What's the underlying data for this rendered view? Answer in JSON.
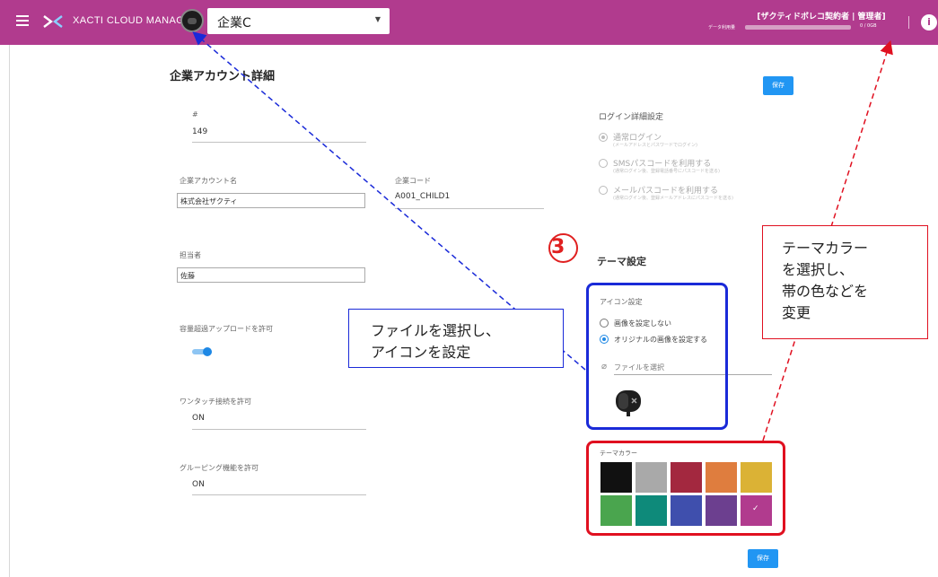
{
  "header": {
    "app_title": "XACTI CLOUD MANAGER",
    "company_selected": "企業C",
    "user_role": "[ザクティドボレコ契約者 | 管理者]",
    "usage_label": "データ利用量",
    "usage_text": "0 / 0GB",
    "usage_fraction": 0,
    "info_icon": "i",
    "accent_color": "#b13b8e"
  },
  "page": {
    "title": "企業アカウント詳細",
    "save_label": "保存"
  },
  "fields": {
    "id_label": "#",
    "id_value": "149",
    "company_name_label": "企業アカウント名",
    "company_name_value": "株式会社ザクティ",
    "company_code_label": "企業コード",
    "company_code_value": "A001_CHILD1",
    "contact_label": "担当者",
    "contact_value": "佐藤",
    "upload_label": "容量超過アップロードを許可",
    "upload_enabled": true,
    "onetouch_label": "ワンタッチ接続を許可",
    "onetouch_value": "ON",
    "grouping_label": "グルーピング機能を許可",
    "grouping_value": "ON"
  },
  "login": {
    "title": "ログイン詳細設定",
    "options": [
      {
        "label": "通常ログイン",
        "sub": "(メールアドレスとパスワードでログイン)",
        "selected": true
      },
      {
        "label": "SMSパスコードを利用する",
        "sub": "(通常ログイン後、登録電話番号にパスコードを送る)",
        "selected": false
      },
      {
        "label": "メールパスコードを利用する",
        "sub": "(通常ログイン後、登録メールアドレスにパスコードを送る)",
        "selected": false
      }
    ]
  },
  "theme": {
    "step_number": "3",
    "title": "テーマ設定",
    "icon_settings_label": "アイコン設定",
    "icon_options": [
      {
        "label": "画像を設定しない",
        "selected": false
      },
      {
        "label": "オリジナルの画像を設定する",
        "selected": true
      }
    ],
    "file_select_label": "ファイルを選択",
    "theme_color_label": "テーマカラー",
    "colors": [
      "#111111",
      "#a9a9a9",
      "#a3283f",
      "#df7d3e",
      "#dbb235",
      "#4aa54e",
      "#0e8a7a",
      "#3f4fad",
      "#6c3f8f",
      "#b13b8e"
    ],
    "selected_color_index": 9,
    "check_mark": "✓"
  },
  "callouts": {
    "blue_line1": "ファイルを選択し、",
    "blue_line2": "アイコンを設定",
    "red_line1": "テーマカラー",
    "red_line2": "を選択し、",
    "red_line3": "帯の色などを",
    "red_line4": "変更",
    "blue_color": "#1a2ad8",
    "red_color": "#e01020"
  }
}
